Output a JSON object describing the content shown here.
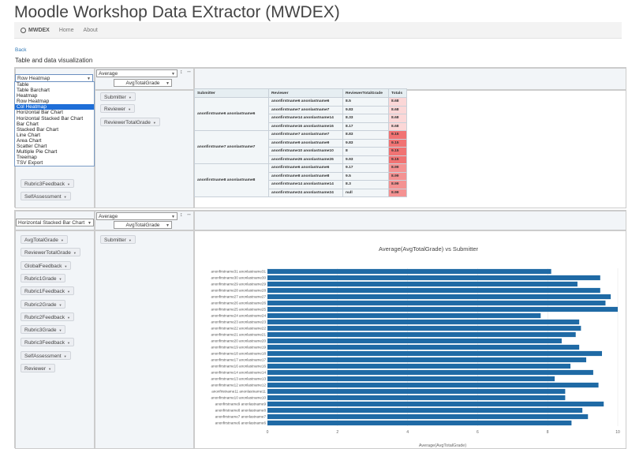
{
  "app": {
    "title": "Moodle Workshop Data EXtractor (MWDEX)"
  },
  "nav": {
    "brand": "MWDEX",
    "items": [
      "Home",
      "About"
    ]
  },
  "back_label": "Back",
  "page_subtitle": "Table and data visualization",
  "pivot1": {
    "renderer_selected": "Row Heatmap",
    "renderer_options": [
      "Table",
      "Table Barchart",
      "Heatmap",
      "Row Heatmap",
      "Col Heatmap",
      "Horizontal Bar Chart",
      "Horizontal Stacked Bar Chart",
      "Bar Chart",
      "Stacked Bar Chart",
      "Line Chart",
      "Area Chart",
      "Scatter Chart",
      "Multiple Pie Chart",
      "Treemap",
      "TSV Export"
    ],
    "renderer_highlighted": "Col Heatmap",
    "aggregator": "Average",
    "aggregator_field": "AvgTotalGrade",
    "row_fields": [
      "Submitter",
      "Reviewer",
      "ReviewerTotalGrade"
    ],
    "unused_fields": [
      "Rubric3Feedback",
      "SelfAssessment"
    ],
    "table": {
      "headers": [
        "Submitter",
        "Reviewer",
        "ReviewerTotalGrade",
        "Totals"
      ],
      "groups": [
        {
          "submitter": "anonfirstname6 anonlastname6",
          "rows": [
            {
              "reviewer": "anonfirstname6 anonlastname6",
              "grade": "8.5",
              "total": "8.68"
            },
            {
              "reviewer": "anonfirstname7 anonlastname7",
              "grade": "9.83",
              "total": "8.68"
            },
            {
              "reviewer": "anonfirstname14 anonlastname14",
              "grade": "8.33",
              "total": "8.68"
            },
            {
              "reviewer": "anonfirstname16 anonlastname16",
              "grade": "8.17",
              "total": "8.68"
            }
          ]
        },
        {
          "submitter": "anonfirstname7 anonlastname7",
          "rows": [
            {
              "reviewer": "anonfirstname7 anonlastname7",
              "grade": "8.83",
              "total": "9.15"
            },
            {
              "reviewer": "anonfirstname9 anonlastname9",
              "grade": "9.83",
              "total": "9.15"
            },
            {
              "reviewer": "anonfirstname10 anonlastname10",
              "grade": "8",
              "total": "9.15"
            },
            {
              "reviewer": "anonfirstname26 anonlastname26",
              "grade": "9.93",
              "total": "9.15"
            }
          ]
        },
        {
          "submitter": "anonfirstname8 anonlastname8",
          "rows": [
            {
              "reviewer": "anonfirstname6 anonlastname6",
              "grade": "9.17",
              "total": "8.99"
            },
            {
              "reviewer": "anonfirstname8 anonlastname8",
              "grade": "9.5",
              "total": "8.99"
            },
            {
              "reviewer": "anonfirstname14 anonlastname14",
              "grade": "8.3",
              "total": "8.99"
            },
            {
              "reviewer": "anonfirstname24 anonlastname24",
              "grade": "null",
              "total": "8.99"
            }
          ]
        }
      ]
    }
  },
  "pivot2": {
    "renderer_selected": "Horizontal Stacked Bar Chart",
    "aggregator": "Average",
    "aggregator_field": "AvgTotalGrade",
    "row_fields": [
      "Submitter"
    ],
    "unused_fields": [
      "AvgTotalGrade",
      "ReviewerTotalGrade",
      "GlobalFeedback",
      "Rubric1Grade",
      "Rubric1Feedback",
      "Rubric2Grade",
      "Rubric2Feedback",
      "Rubric3Grade",
      "Rubric3Feedback",
      "SelfAssessment",
      "Reviewer"
    ]
  },
  "colors": {
    "bar": "#1f6aa5",
    "heat": "#f08080",
    "highlight": "#1e6ed8"
  },
  "chart_data": {
    "type": "bar",
    "orientation": "horizontal",
    "title": "Average(AvgTotalGrade) vs Submitter",
    "xlabel": "Average(AvgTotalGrade)",
    "xlim": [
      0,
      10
    ],
    "xticks": [
      "0",
      "2",
      "4",
      "6",
      "8",
      "10"
    ],
    "grid": true,
    "categories": [
      "anonfirstname31 anonlastname31",
      "anonfirstname30 anonlastname30",
      "anonfirstname29 anonlastname29",
      "anonfirstname28 anonlastname28",
      "anonfirstname27 anonlastname27",
      "anonfirstname26 anonlastname26",
      "anonfirstname25 anonlastname25",
      "anonfirstname24 anonlastname24",
      "anonfirstname23 anonlastname23",
      "anonfirstname22 anonlastname22",
      "anonfirstname21 anonlastname21",
      "anonfirstname20 anonlastname20",
      "anonfirstname19 anonlastname19",
      "anonfirstname18 anonlastname18",
      "anonfirstname17 anonlastname17",
      "anonfirstname16 anonlastname16",
      "anonfirstname14 anonlastname14",
      "anonfirstname13 anonlastname13",
      "anonfirstname12 anonlastname12",
      "anonfirstname11 anonlastname11",
      "anonfirstname10 anonlastname10",
      "anonfirstname9 anonlastname9",
      "anonfirstname8 anonlastname8",
      "anonfirstname7 anonlastname7",
      "anonfirstname6 anonlastname6"
    ],
    "values": [
      8.1,
      9.5,
      8.85,
      9.5,
      9.8,
      9.65,
      10.0,
      7.8,
      8.9,
      8.95,
      8.8,
      8.4,
      8.9,
      9.55,
      9.1,
      8.65,
      9.3,
      8.2,
      9.45,
      8.5,
      8.5,
      9.6,
      8.99,
      9.15,
      8.68
    ]
  }
}
